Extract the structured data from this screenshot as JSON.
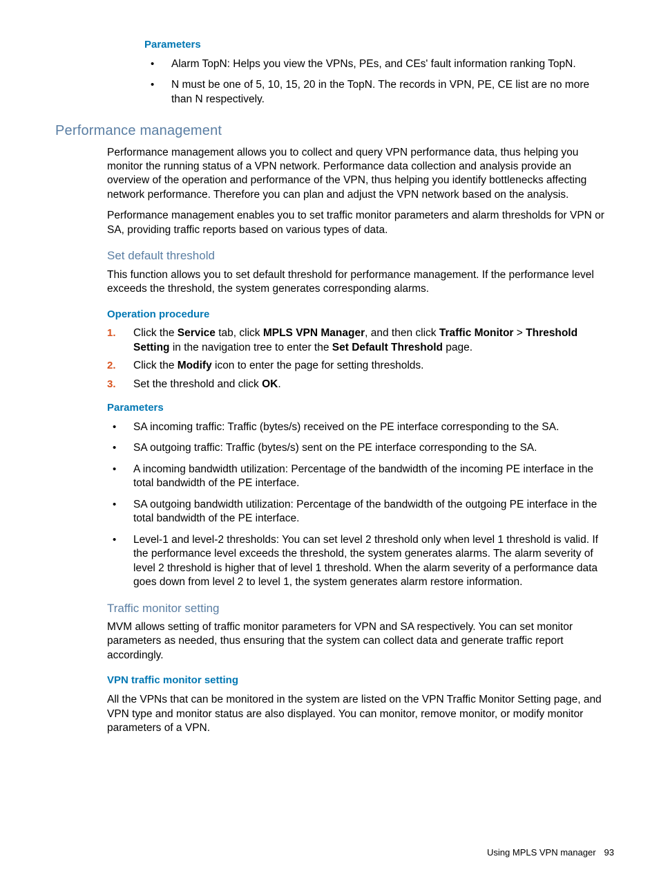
{
  "sec1": {
    "params_heading": "Parameters",
    "bullets": [
      "Alarm TopN: Helps you view the VPNs, PEs, and CEs' fault information ranking TopN.",
      "N must be one of 5, 10, 15, 20 in the TopN. The records in VPN, PE, CE list are no more than N respectively."
    ]
  },
  "perf": {
    "heading": "Performance management",
    "p1": "Performance management allows you to collect and query VPN performance data, thus helping you monitor the running status of a VPN network. Performance data collection and analysis provide an overview of the operation and performance of the VPN, thus helping you identify bottlenecks affecting network performance. Therefore you can plan and adjust the VPN network based on the analysis.",
    "p2": "Performance management enables you to set traffic monitor parameters and alarm thresholds for VPN or SA, providing traffic reports based on various types of data."
  },
  "threshold": {
    "heading": "Set default threshold",
    "p1": "This function allows you to set default threshold for performance management. If the performance level exceeds the threshold, the system generates corresponding alarms.",
    "op_heading": "Operation procedure",
    "step1_a": "Click the ",
    "step1_b": "Service",
    "step1_c": " tab, click ",
    "step1_d": "MPLS VPN Manager",
    "step1_e": ", and then click ",
    "step1_f": "Traffic Monitor",
    "step1_g": " > ",
    "step1_h": "Threshold Setting",
    "step1_i": " in the navigation tree to enter the ",
    "step1_j": "Set Default Threshold",
    "step1_k": " page.",
    "step2_a": "Click the ",
    "step2_b": "Modify",
    "step2_c": " icon to enter the page for setting thresholds.",
    "step3_a": "Set the threshold and click ",
    "step3_b": "OK",
    "step3_c": ".",
    "params_heading": "Parameters",
    "bullets": [
      "SA incoming traffic: Traffic (bytes/s) received on the PE interface corresponding to the SA.",
      "SA outgoing traffic: Traffic (bytes/s) sent on the PE interface corresponding to the SA.",
      "A incoming bandwidth utilization: Percentage of the bandwidth of the incoming PE interface in the total bandwidth of the PE interface.",
      "SA outgoing bandwidth utilization: Percentage of the bandwidth of the outgoing PE interface in the total bandwidth of the PE interface.",
      "Level-1 and level-2 thresholds: You can set level 2 threshold only when level 1 threshold is valid. If the performance level exceeds the threshold, the system generates alarms. The alarm severity of level 2 threshold is higher that of level 1 threshold. When the alarm severity of a performance data goes down from level 2 to level 1, the system generates alarm restore information."
    ]
  },
  "traffic": {
    "heading": "Traffic monitor setting",
    "p1": "MVM allows setting of traffic monitor parameters for VPN and SA respectively. You can set monitor parameters as needed, thus ensuring that the system can collect data and generate traffic report accordingly.",
    "vpn_heading": "VPN traffic monitor setting",
    "p2": "All the VPNs that can be monitored in the system are listed on the VPN Traffic Monitor Setting page, and VPN type and monitor status are also displayed. You can monitor, remove monitor, or modify monitor parameters of a VPN."
  },
  "footer": {
    "text": "Using MPLS VPN manager",
    "page": "93"
  }
}
